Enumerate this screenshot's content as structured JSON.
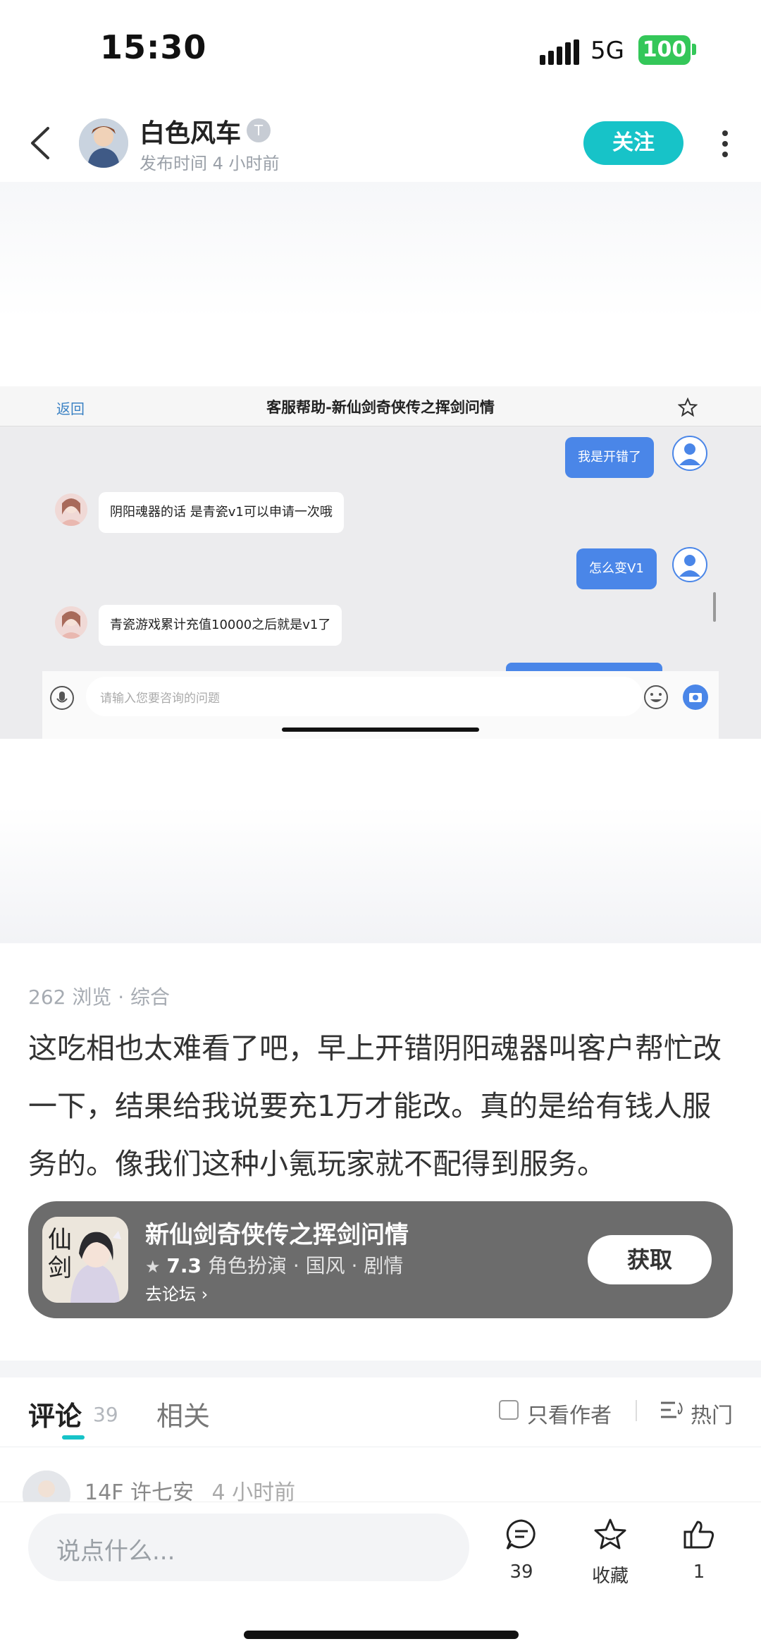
{
  "status": {
    "time": "15:30",
    "network": "5G",
    "battery": "100",
    "colors": {
      "battery": "#34c759"
    }
  },
  "header": {
    "username": "白色风车",
    "level_badge": "T",
    "post_time": "发布时间 4 小时前",
    "follow_label": "关注",
    "icons": [
      "back-icon",
      "more-icon"
    ]
  },
  "screenshot": {
    "back_label": "返回",
    "title": "客服帮助-新仙剑奇侠传之挥剑问情",
    "messages": [
      {
        "from": "user",
        "text": "我是开错了"
      },
      {
        "from": "agent",
        "text": "阴阳魂器的话 是青瓷v1可以申请一次哦"
      },
      {
        "from": "user",
        "text": "怎么变V1"
      },
      {
        "from": "agent",
        "text": "青瓷游戏累计充值10000之后就是v1了"
      }
    ],
    "input_placeholder": "请输入您要咨询的问题"
  },
  "post": {
    "meta": "262 浏览 · 综合",
    "body": "这吃相也太难看了吧，早上开错阴阳魂器叫客户帮忙改一下，结果给我说要充1万才能改。真的是给有钱人服务的。像我们这种小氪玩家就不配得到服务。"
  },
  "game_card": {
    "title": "新仙剑奇侠传之挥剑问情",
    "rating": "7.3",
    "tags": "角色扮演 · 国风 · 剧情",
    "forum_link": "去论坛",
    "get_label": "获取"
  },
  "tabs": {
    "comments_label": "评论",
    "comments_count": "39",
    "related_label": "相关",
    "author_only_label": "只看作者",
    "sort_label": "热门",
    "accent": "#17c3c8"
  },
  "comment": {
    "floor": "14F",
    "user": "许七安",
    "time": "4 小时前"
  },
  "bottom": {
    "input_placeholder": "说点什么...",
    "comment_count": "39",
    "favorite_label": "收藏",
    "like_count": "1"
  }
}
